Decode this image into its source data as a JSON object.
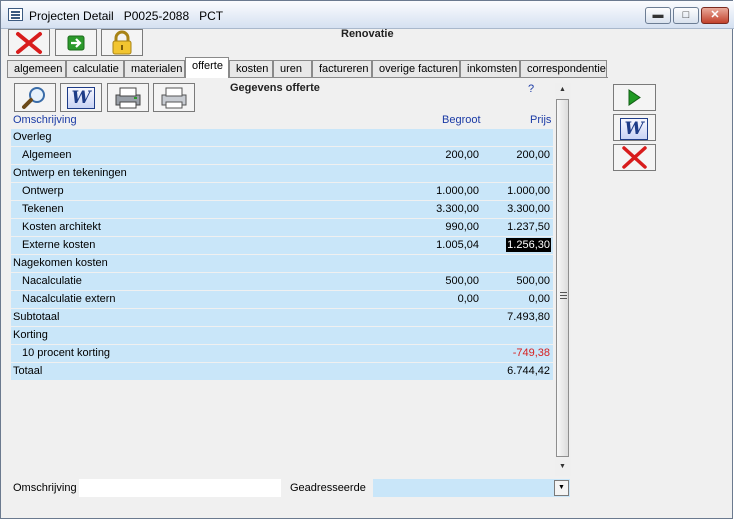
{
  "window": {
    "title": "Projecten Detail",
    "project_code": "P0025-2088",
    "project_suffix": "PCT"
  },
  "header": {
    "project_name": "Renovatie"
  },
  "tabs": [
    {
      "label": "algemeen"
    },
    {
      "label": "calculatie"
    },
    {
      "label": "materialen"
    },
    {
      "label": "offerte",
      "active": true
    },
    {
      "label": "kosten"
    },
    {
      "label": "uren"
    },
    {
      "label": "factureren"
    },
    {
      "label": "overige facturen"
    },
    {
      "label": "inkomsten"
    },
    {
      "label": "correspondentie"
    }
  ],
  "offer": {
    "title": "Gegevens offerte",
    "help": "?",
    "columns": {
      "description": "Omschrijving",
      "budget": "Begroot",
      "price": "Prijs"
    },
    "rows": [
      {
        "label": "Overleg",
        "type": "category",
        "budget": "",
        "price": ""
      },
      {
        "label": "Algemeen",
        "type": "item",
        "budget": "200,00",
        "price": "200,00"
      },
      {
        "label": "Ontwerp en tekeningen",
        "type": "category",
        "budget": "",
        "price": ""
      },
      {
        "label": "Ontwerp",
        "type": "item",
        "budget": "1.000,00",
        "price": "1.000,00"
      },
      {
        "label": "Tekenen",
        "type": "item",
        "budget": "3.300,00",
        "price": "3.300,00"
      },
      {
        "label": "Kosten architekt",
        "type": "item",
        "budget": "990,00",
        "price": "1.237,50"
      },
      {
        "label": "Externe kosten",
        "type": "item",
        "budget": "1.005,04",
        "price": "1.256,30",
        "selected": true
      },
      {
        "label": "Nagekomen kosten",
        "type": "category",
        "budget": "",
        "price": ""
      },
      {
        "label": "Nacalculatie",
        "type": "item",
        "budget": "500,00",
        "price": "500,00"
      },
      {
        "label": "Nacalculatie extern",
        "type": "item",
        "budget": "0,00",
        "price": "0,00"
      },
      {
        "label": "Subtotaal",
        "type": "category",
        "budget": "",
        "price": "7.493,80"
      },
      {
        "label": "Korting",
        "type": "category",
        "budget": "",
        "price": ""
      },
      {
        "label": "10 procent korting",
        "type": "item",
        "budget": "",
        "price": "-749,38",
        "negative": true
      },
      {
        "label": "Totaal",
        "type": "category",
        "budget": "",
        "price": "6.744,42"
      }
    ]
  },
  "footer": {
    "description_label": "Omschrijving",
    "description_value": "",
    "addressee_label": "Geadresseerde",
    "addressee_value": ""
  },
  "colors": {
    "row_bg": "#c9e6f9",
    "header_text": "#1a3aa5",
    "negative": "#d62020"
  }
}
